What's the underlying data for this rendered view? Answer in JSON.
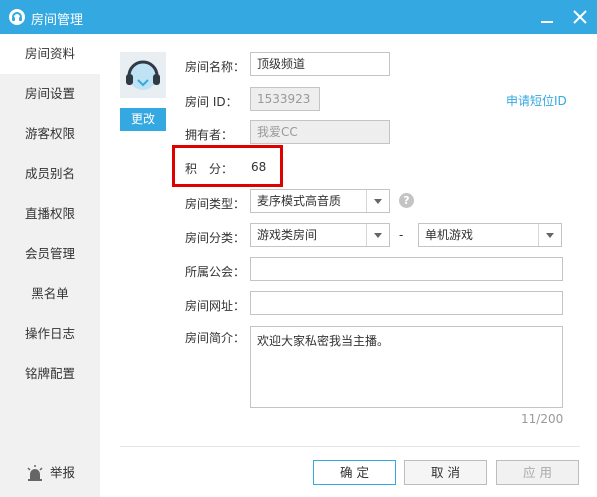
{
  "window": {
    "title": "房间管理",
    "accent": "#34a8e1",
    "buttons": [
      "minimize-icon",
      "close-icon"
    ]
  },
  "sidebar": {
    "items": [
      {
        "label": "房间资料",
        "active": true
      },
      {
        "label": "房间设置"
      },
      {
        "label": "游客权限"
      },
      {
        "label": "成员别名"
      },
      {
        "label": "直播权限"
      },
      {
        "label": "会员管理"
      },
      {
        "label": "黑名单"
      },
      {
        "label": "操作日志"
      },
      {
        "label": "铭牌配置"
      }
    ],
    "report": {
      "label": "举报",
      "icon": "alarm-icon"
    }
  },
  "profile": {
    "avatar_icon": "headphones-avatar-icon",
    "change_label": "更改"
  },
  "form": {
    "name": {
      "label": "房间名称：",
      "value": "顶级频道"
    },
    "id": {
      "label": "房间 ID：",
      "value": "1533923"
    },
    "apply_short_id": "申请短位ID",
    "owner": {
      "label": "拥有者：",
      "value": "我爱CC"
    },
    "points": {
      "label": "积　分：",
      "value": "68"
    },
    "type": {
      "label": "房间类型：",
      "value": "麦序模式高音质"
    },
    "category": {
      "label": "房间分类：",
      "value": "游戏类房间",
      "separator": "-",
      "sub_value": "单机游戏"
    },
    "guild": {
      "label": "所属公会：",
      "value": ""
    },
    "url": {
      "label": "房间网址：",
      "value": ""
    },
    "intro": {
      "label": "房间简介：",
      "value": "欢迎大家私密我当主播。",
      "counter": "11/200"
    }
  },
  "footer": {
    "ok": "确 定",
    "cancel": "取 消",
    "apply": "应 用"
  },
  "highlight_color": "#e00000"
}
